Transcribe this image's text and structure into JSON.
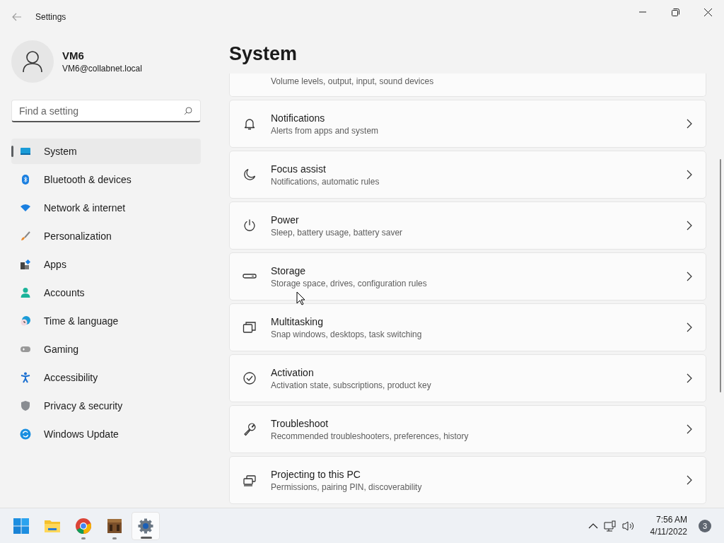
{
  "window": {
    "title": "Settings"
  },
  "profile": {
    "name": "VM6",
    "email": "VM6@collabnet.local"
  },
  "search": {
    "placeholder": "Find a setting"
  },
  "nav": [
    {
      "label": "System",
      "selected": true
    },
    {
      "label": "Bluetooth & devices",
      "selected": false
    },
    {
      "label": "Network & internet",
      "selected": false
    },
    {
      "label": "Personalization",
      "selected": false
    },
    {
      "label": "Apps",
      "selected": false
    },
    {
      "label": "Accounts",
      "selected": false
    },
    {
      "label": "Time & language",
      "selected": false
    },
    {
      "label": "Gaming",
      "selected": false
    },
    {
      "label": "Accessibility",
      "selected": false
    },
    {
      "label": "Privacy & security",
      "selected": false
    },
    {
      "label": "Windows Update",
      "selected": false
    }
  ],
  "page_title": "System",
  "cards": [
    {
      "kind": "partial",
      "subtitle": "Volume levels, output, input, sound devices"
    },
    {
      "kind": "full",
      "title": "Notifications",
      "subtitle": "Alerts from apps and system"
    },
    {
      "kind": "full",
      "title": "Focus assist",
      "subtitle": "Notifications, automatic rules"
    },
    {
      "kind": "full",
      "title": "Power",
      "subtitle": "Sleep, battery usage, battery saver"
    },
    {
      "kind": "full",
      "title": "Storage",
      "subtitle": "Storage space, drives, configuration rules"
    },
    {
      "kind": "full",
      "title": "Multitasking",
      "subtitle": "Snap windows, desktops, task switching"
    },
    {
      "kind": "full",
      "title": "Activation",
      "subtitle": "Activation state, subscriptions, product key"
    },
    {
      "kind": "full",
      "title": "Troubleshoot",
      "subtitle": "Recommended troubleshooters, preferences, history"
    },
    {
      "kind": "full",
      "title": "Projecting to this PC",
      "subtitle": "Permissions, pairing PIN, discoverability"
    }
  ],
  "taskbar": {
    "apps": [
      {
        "running": false,
        "selected": false
      },
      {
        "running": false,
        "selected": false
      },
      {
        "running": true,
        "selected": false
      },
      {
        "running": true,
        "selected": false
      },
      {
        "running": true,
        "selected": true
      }
    ],
    "time": "7:56 AM",
    "date": "4/11/2022",
    "notifications": "3"
  }
}
